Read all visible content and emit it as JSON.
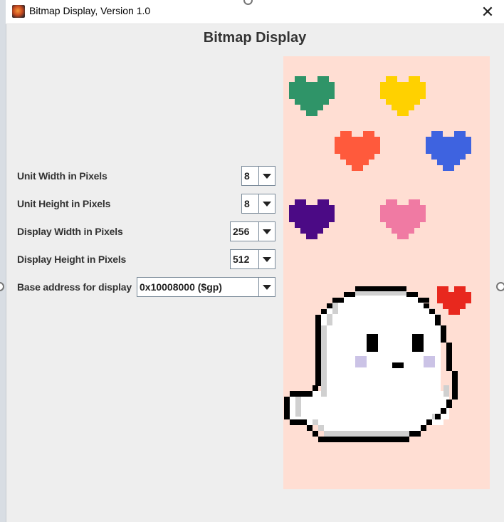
{
  "window": {
    "title": "Bitmap Display, Version 1.0",
    "close_icon": "close-icon",
    "app_icon": "app-icon"
  },
  "panel": {
    "title": "Bitmap Display"
  },
  "settings": [
    {
      "label": "Unit Width in Pixels",
      "value": "8"
    },
    {
      "label": "Unit Height in Pixels",
      "value": "8"
    },
    {
      "label": "Display Width in Pixels",
      "value": "256"
    },
    {
      "label": "Display Height in Pixels",
      "value": "512"
    },
    {
      "label": "Base address for display",
      "value": "0x10008000 ($gp)"
    }
  ],
  "bitmap": {
    "background": "#ffded3",
    "heart_colors": {
      "green": "#2f9468",
      "yellow": "#ffd100",
      "orange": "#ff5a3c",
      "blue": "#3e63e0",
      "purple": "#4b0a85",
      "pink": "#f07aa3",
      "red": "#e8281e"
    },
    "ghost_colors": {
      "outline": "#000000",
      "body": "#ffffff",
      "shade": "#d0d0d0",
      "blush": "#cbc3e6"
    }
  }
}
